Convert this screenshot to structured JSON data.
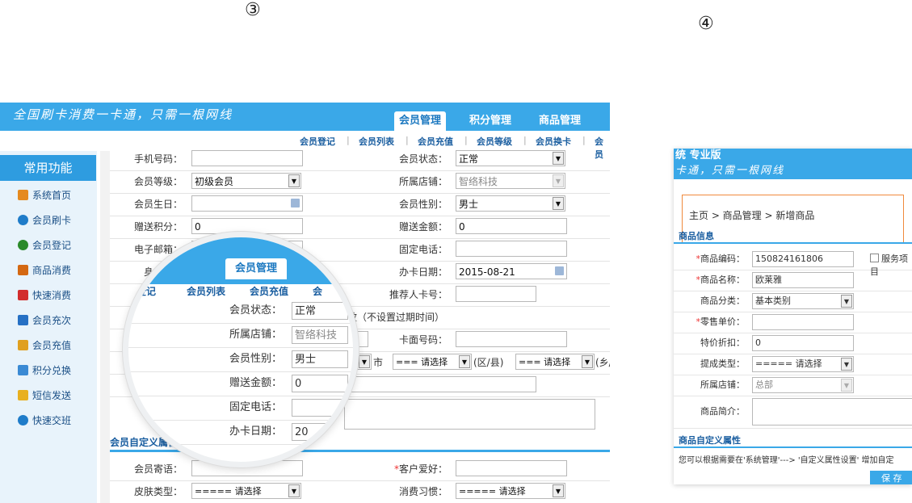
{
  "steps": {
    "s3": "③",
    "s4": "④"
  },
  "shot3": {
    "slogan": "全国刷卡消费一卡通，只需一根网线",
    "nav_tabs": [
      "会员管理",
      "积分管理",
      "商品管理"
    ],
    "sub_nav": [
      "会员登记",
      "会员列表",
      "会员充值",
      "会员等级",
      "会员换卡",
      "会员"
    ],
    "sidebar": {
      "title": "常用功能",
      "items": [
        "系统首页",
        "会员刷卡",
        "会员登记",
        "商品消费",
        "快速消费",
        "会员充次",
        "会员充值",
        "积分兑换",
        "短信发送",
        "快速交班"
      ]
    },
    "form": {
      "phone_label": "手机号码：",
      "status_label": "会员状态：",
      "status_value": "正常",
      "level_label": "会员等级：",
      "level_value": "初级会员",
      "store_label": "所属店铺：",
      "store_value": "智络科技",
      "birthday_label": "会员生日：",
      "gender_label": "会员性别：",
      "gender_value": "男士",
      "points_label": "赠送积分：",
      "points_value": "0",
      "amount_label": "赠送金额：",
      "amount_value": "0",
      "email_label": "电子邮箱：",
      "tel_label": "固定电话：",
      "id_label": "身份证：",
      "date_label": "办卡日期：",
      "date_value": "2015-08-21",
      "referrer_label": "推荐人卡号：",
      "validity_text": "有效（不设置过期时间）",
      "cardface_label": "卡面号码：",
      "city_suffix": "市",
      "district_select": "=== 请选择 ===",
      "district_suffix": "(区/县)",
      "town_select": "=== 请选择 ===",
      "town_suffix": "(乡/",
      "custom_section": "会员自定义属性",
      "mail_label": "会员寄语：",
      "hobby_label": "客户爱好：",
      "skin_label": "皮肤类型：",
      "skin_value": "===== 请选择 =====",
      "habit_label": "消费习惯：",
      "habit_value": "===== 请选择 ====="
    },
    "magnifier": {
      "tab": "会员管理",
      "sub": [
        "登记",
        "会员列表",
        "会员充值",
        "会"
      ],
      "rows": [
        {
          "label": "会员状态：",
          "value": "正常"
        },
        {
          "label": "所属店铺：",
          "value": "智络科技"
        },
        {
          "label": "会员性别：",
          "value": "男士"
        },
        {
          "label": "赠送金额：",
          "value": "0"
        },
        {
          "label": "固定电话：",
          "value": ""
        },
        {
          "label": "办卡日期：",
          "value": "20"
        }
      ],
      "custom_section": "会员自定义属性"
    }
  },
  "shot4": {
    "title_a": "统 专业版",
    "title_b": "卡通，只需一根网线",
    "breadcrumb": "主页 > 商品管理 > 新增商品",
    "section1": "商品信息",
    "rows": [
      {
        "label": "商品编码：",
        "value": "150824161806",
        "required": true
      },
      {
        "label": "商品名称：",
        "value": "欧莱雅",
        "required": true
      },
      {
        "label": "商品分类：",
        "value": "基本类别",
        "required": false
      },
      {
        "label": "零售单价：",
        "value": "",
        "required": true
      },
      {
        "label": "特价折扣：",
        "value": "0",
        "required": false
      },
      {
        "label": "提成类型：",
        "value": "===== 请选择 =====",
        "required": false
      },
      {
        "label": "所属店铺：",
        "value": "总部",
        "required": false
      },
      {
        "label": "商品简介：",
        "value": "",
        "required": false
      }
    ],
    "service_checkbox": "服务项目",
    "section2": "商品自定义属性",
    "hint": "您可以根据需要在'系统管理'---> '自定义属性设置' 增加自定",
    "save": "保 存"
  }
}
